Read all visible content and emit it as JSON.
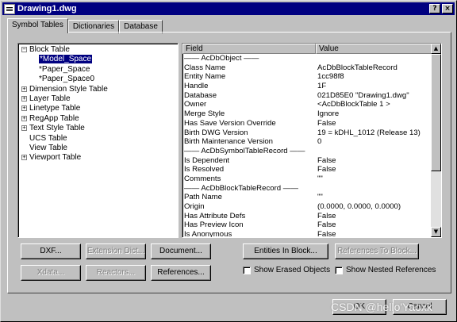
{
  "window": {
    "title": "Drawing1.dwg",
    "help_button": "?",
    "close_button": "×"
  },
  "tabs": [
    {
      "label": "Symbol Tables",
      "active": true
    },
    {
      "label": "Dictionaries",
      "active": false
    },
    {
      "label": "Database",
      "active": false
    }
  ],
  "tree": {
    "items": [
      {
        "label": "Block Table",
        "expander": "−",
        "level": 0
      },
      {
        "label": "*Model_Space",
        "level": 1,
        "selected": true
      },
      {
        "label": "*Paper_Space",
        "level": 1
      },
      {
        "label": "*Paper_Space0",
        "level": 1
      },
      {
        "label": "Dimension Style Table",
        "expander": "+",
        "level": 0
      },
      {
        "label": "Layer Table",
        "expander": "+",
        "level": 0
      },
      {
        "label": "Linetype Table",
        "expander": "+",
        "level": 0
      },
      {
        "label": "RegApp Table",
        "expander": "+",
        "level": 0
      },
      {
        "label": "Text Style Table",
        "expander": "+",
        "level": 0
      },
      {
        "label": "UCS Table",
        "level": 0
      },
      {
        "label": "View Table",
        "level": 0
      },
      {
        "label": "Viewport Table",
        "expander": "+",
        "level": 0
      }
    ]
  },
  "grid": {
    "columns": {
      "field": "Field",
      "value": "Value"
    },
    "rows": [
      {
        "section": "—— AcDbObject ——"
      },
      {
        "field": "Class Name",
        "value": "AcDbBlockTableRecord"
      },
      {
        "field": "Entity Name",
        "value": "1cc98f8"
      },
      {
        "field": "Handle",
        "value": "1F"
      },
      {
        "field": "Database",
        "value": "021D85E0  \"Drawing1.dwg\""
      },
      {
        "field": "Owner",
        "value": "<AcDbBlockTable      1  >"
      },
      {
        "field": "Merge Style",
        "value": "Ignore"
      },
      {
        "field": "Has Save Version Override",
        "value": "False"
      },
      {
        "field": "Birth DWG Version",
        "value": "19 = kDHL_1012  (Release 13)"
      },
      {
        "field": "Birth Maintenance Version",
        "value": "0"
      },
      {
        "section": "—— AcDbSymbolTableRecord ——"
      },
      {
        "field": "Is Dependent",
        "value": "False"
      },
      {
        "field": "Is Resolved",
        "value": "False"
      },
      {
        "field": "Comments",
        "value": "\"\""
      },
      {
        "section": "—— AcDbBlockTableRecord ——"
      },
      {
        "field": "Path Name",
        "value": "\"\""
      },
      {
        "field": "Origin",
        "value": "(0.0000, 0.0000, 0.0000)"
      },
      {
        "field": "Has Attribute Defs",
        "value": "False"
      },
      {
        "field": "Has Preview Icon",
        "value": "False"
      },
      {
        "field": "Is Anonymous",
        "value": "False"
      }
    ]
  },
  "buttons": {
    "dxf": "DXF...",
    "extension_dict": "Extension Dict...",
    "document": "Document...",
    "entities_in_block": "Entities In Block...",
    "references_to_block": "References To Block...",
    "xdata": "Xdata...",
    "reactors": "Reactors...",
    "references": "References...",
    "ok": "OK",
    "cancel": "Cancel"
  },
  "checkboxes": {
    "show_erased": "Show Erased Objects",
    "show_nested": "Show Nested References"
  },
  "watermark": "CSDN @hello'Yaoxk"
}
